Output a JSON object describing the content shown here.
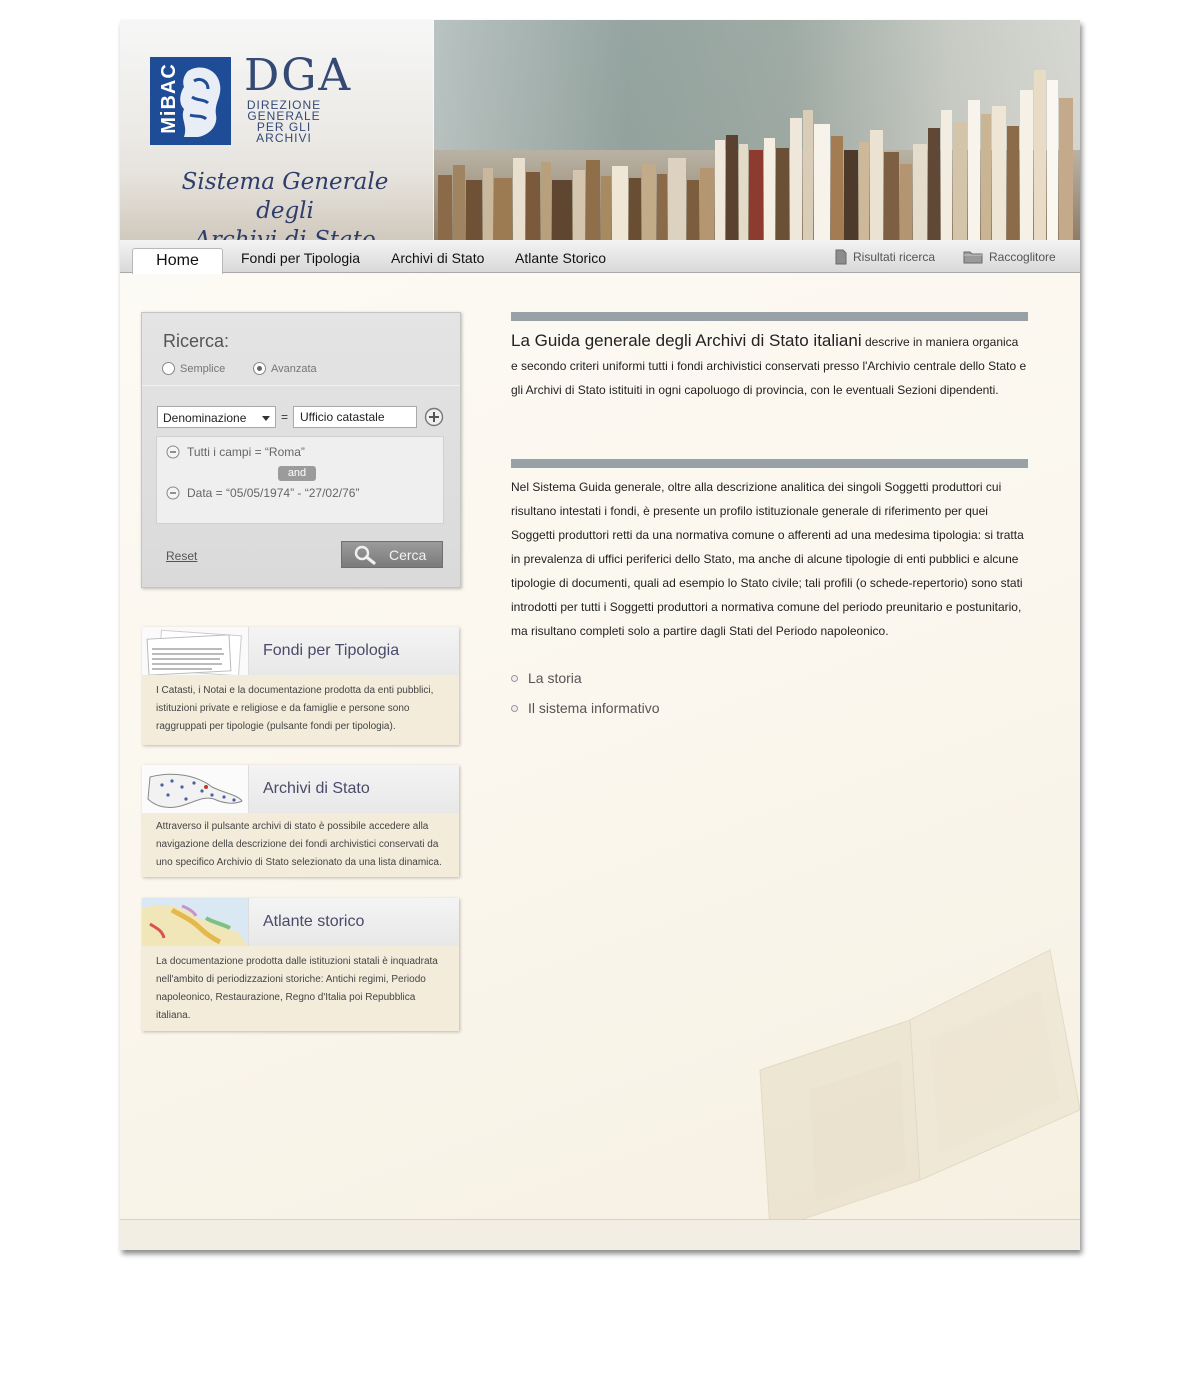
{
  "header": {
    "logo_left": "MiBAC",
    "logo_main": "DGA",
    "logo_sub": [
      "DIREZIONE",
      "GENERALE",
      "PER GLI",
      "ARCHIVI"
    ],
    "site_title_line1": "Sistema Generale degli",
    "site_title_line2": "Archivi di Stato Italiani"
  },
  "nav": {
    "tabs": [
      {
        "label": "Home"
      },
      {
        "label": "Fondi per Tipologia"
      },
      {
        "label": "Archivi di Stato"
      },
      {
        "label": "Atlante Storico"
      }
    ],
    "right": [
      {
        "label": "Risultati ricerca",
        "icon": "document-icon"
      },
      {
        "label": "Raccoglitore",
        "icon": "folder-icon"
      }
    ]
  },
  "search": {
    "title": "Ricerca:",
    "mode_simple": "Semplice",
    "mode_advanced": "Avanzata",
    "selected_mode": "Avanzata",
    "field_select": "Denominazione",
    "equals": "=",
    "value": "Ufficio catastale",
    "criteria": [
      "Tutti i campi = “Roma”",
      "Data = “05/05/1974” - “27/02/76”"
    ],
    "operator": "and",
    "reset_label": "Reset",
    "submit_label": "Cerca"
  },
  "cards": [
    {
      "title": "Fondi per Tipologia",
      "body": "I Catasti, i Notai e la documentazione prodotta da enti pubblici, istituzioni private e religiose e da famiglie e persone sono raggruppati per tipologie (pulsante fondi per tipologia)."
    },
    {
      "title": "Archivi di Stato",
      "body": "Attraverso il pulsante archivi di stato è possibile accedere alla navigazione della descrizione dei fondi archivistici conservati da uno specifico Archivio di Stato selezionato da una lista dinamica."
    },
    {
      "title": "Atlante storico",
      "body": "La documentazione prodotta dalle istituzioni statali è inquadrata nell'ambito di periodizzazioni storiche: Antichi regimi, Periodo napoleonico, Restaurazione, Regno d'Italia poi Repubblica italiana."
    }
  ],
  "main": {
    "intro_lead": "La Guida generale degli Archivi di Stato italiani",
    "intro_rest": " descrive in maniera organica e secondo criteri uniformi tutti i fondi archivistici conservati presso l'Archivio centrale dello Stato e gli Archivi di Stato istituiti in ogni capoluogo di provincia, con le eventuali Sezioni dipendenti.",
    "paragraph2": "Nel Sistema Guida generale, oltre alla descrizione analitica dei singoli Soggetti produttori cui risultano intestati i fondi, è presente un profilo istituzionale generale di riferimento per quei Soggetti produttori retti da una normativa comune o afferenti ad una medesima tipologia: si tratta in prevalenza di uffici periferici dello Stato, ma anche di alcune tipologie di enti pubblici e alcune tipologie di documenti, quali ad esempio lo Stato civile; tali profili (o schede-repertorio) sono stati introdotti per tutti i Soggetti produttori a normativa comune del periodo preunitario e postunitario, ma risultano completi solo a partire dagli Stati del Periodo napoleonico.",
    "links": [
      {
        "label": "La storia"
      },
      {
        "label": "Il sistema informativo"
      }
    ]
  },
  "colors": {
    "logo_blue": "#1f4c97",
    "bar_gray": "#98a1a6",
    "card_body": "#f3ecdb"
  }
}
